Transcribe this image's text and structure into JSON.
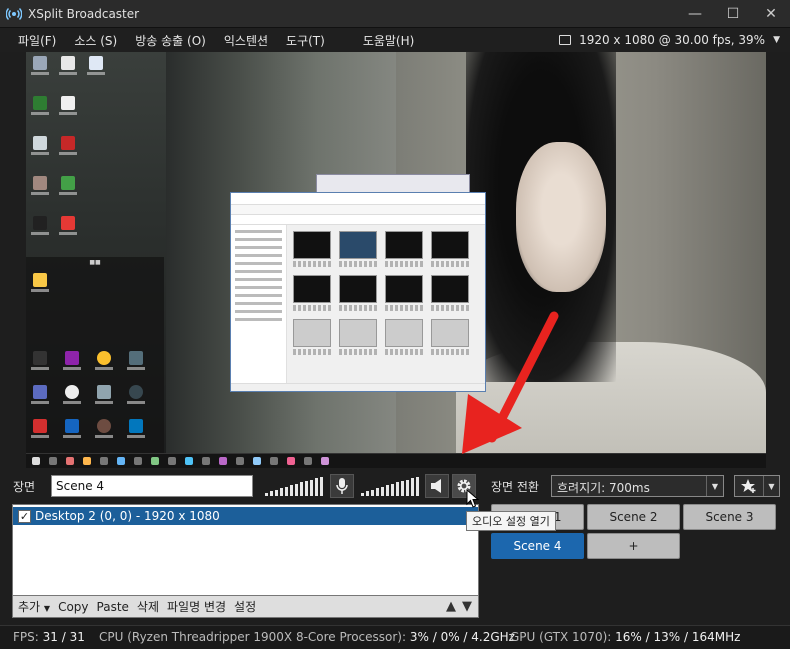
{
  "window": {
    "title": "XSplit Broadcaster",
    "minimize": "—",
    "maximize": "☐",
    "close": "✕"
  },
  "menu": {
    "file": "파일(F)",
    "sources": "소스 (S)",
    "broadcast": "방송 송출 (O)",
    "extensions": "익스텐션",
    "tools": "도구(T)",
    "help": "도움말(H)"
  },
  "resolution": "1920 x 1080 @ 30.00 fps, 39%",
  "scene": {
    "label": "장면",
    "name": "Scene 4"
  },
  "audio": {
    "settings_tooltip": "오디오 설정 열기"
  },
  "transition": {
    "label": "장면 전환",
    "value": "흐려지기: 700ms"
  },
  "sources": {
    "items": [
      {
        "label": "Desktop 2 (0, 0) - 1920 x 1080",
        "checked": true,
        "selected": true
      }
    ],
    "toolbar": {
      "add": "추가",
      "copy": "Copy",
      "paste": "Paste",
      "delete": "삭제",
      "rename": "파일명 변경",
      "settings": "설정",
      "up": "▲",
      "down": "▼"
    }
  },
  "scenes": {
    "buttons": [
      "Scene 1",
      "Scene 2",
      "Scene 3",
      "Scene 4",
      "+"
    ],
    "active": "Scene 4"
  },
  "status": {
    "fps_label": "FPS:",
    "fps_value": "31 / 31",
    "cpu_label": "CPU (Ryzen Threadripper 1900X 8-Core Processor):",
    "cpu_value": "3% / 0% / 4.2GHz",
    "gpu_label": "GPU (GTX 1070):",
    "gpu_value": "16% / 13% / 164MHz"
  },
  "colors": {
    "accent": "#1c67ae",
    "arrow": "#e8231f",
    "background": "#1e1e1e"
  }
}
